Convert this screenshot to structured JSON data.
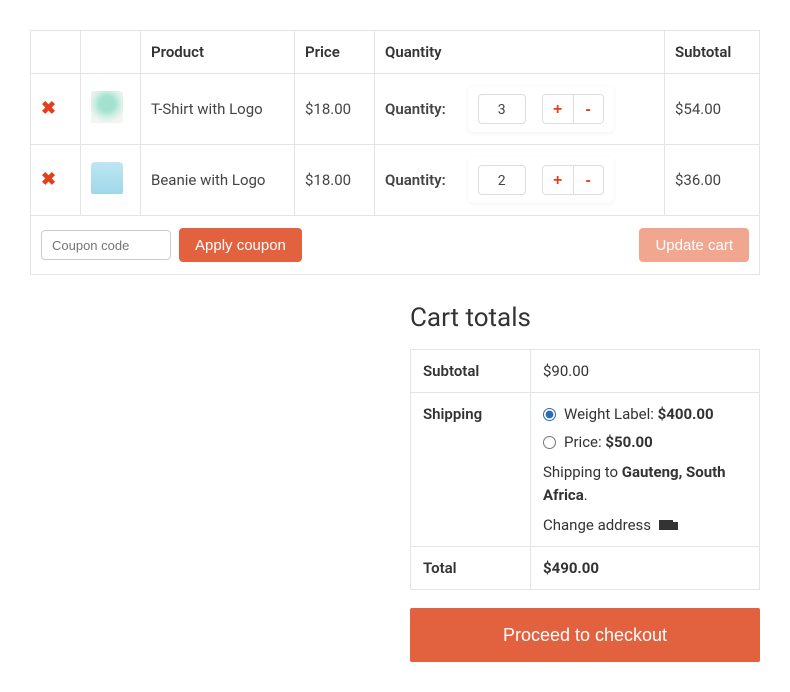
{
  "headers": {
    "product": "Product",
    "price": "Price",
    "quantity": "Quantity",
    "subtotal": "Subtotal"
  },
  "qty_label": "Quantity:",
  "items": [
    {
      "name": "T-Shirt with Logo",
      "price": "$18.00",
      "quantity": "3",
      "subtotal": "$54.00",
      "thumb_class": "tshirt"
    },
    {
      "name": "Beanie with Logo",
      "price": "$18.00",
      "quantity": "2",
      "subtotal": "$36.00",
      "thumb_class": "beanie"
    }
  ],
  "coupon": {
    "placeholder": "Coupon code",
    "apply": "Apply coupon"
  },
  "update_cart": "Update cart",
  "cart_totals": {
    "title": "Cart totals",
    "subtotal_label": "Subtotal",
    "subtotal_value": "$90.00",
    "shipping_label": "Shipping",
    "shipping_options": [
      {
        "label": "Weight Label:",
        "value": "$400.00",
        "checked": true
      },
      {
        "label": "Price:",
        "value": "$50.00",
        "checked": false
      }
    ],
    "shipping_to_prefix": "Shipping to ",
    "shipping_to_location": "Gauteng, South Africa",
    "shipping_to_suffix": ".",
    "change_address": "Change address",
    "total_label": "Total",
    "total_value": "$490.00"
  },
  "checkout": "Proceed to checkout"
}
